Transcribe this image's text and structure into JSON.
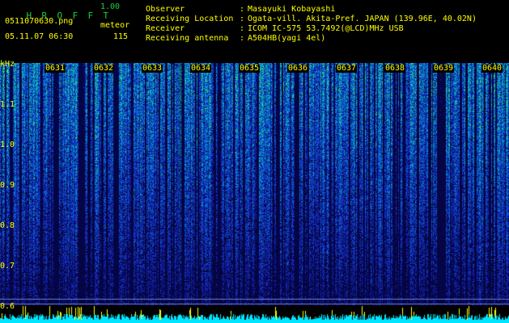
{
  "app": {
    "name_letters": [
      "H",
      "R",
      "O",
      "F",
      "F",
      "T"
    ],
    "version": "1.00"
  },
  "file": {
    "name": "0511070630.png",
    "datetime": "05.11.07 06:30"
  },
  "meteor": {
    "label": "meteor",
    "count": "115"
  },
  "info": [
    {
      "key": "Observer",
      "value": "Masayuki Kobayashi"
    },
    {
      "key": "Receiving Location",
      "value": "Ogata-vill. Akita-Pref. JAPAN (139.96E, 40.02N)"
    },
    {
      "key": "Receiver",
      "value": "ICOM IC-575 53.7492(@LCD)MHz USB"
    },
    {
      "key": "Receiving antenna",
      "value": "A504HB(yagi 4el)"
    }
  ],
  "axis": {
    "unit": "kHz",
    "y_ticks": [
      "1.1",
      "1.0",
      "0.9",
      "0.8",
      "0.7",
      "0.6"
    ],
    "x_ticks": [
      "0631",
      "0632",
      "0633",
      "0634",
      "0635",
      "0636",
      "0637",
      "0638",
      "0639",
      "0640"
    ]
  },
  "colors": {
    "accent_yellow": "#ffff00",
    "logo_green": "#1fcf3a",
    "baseline_cyan": "#00e5ff"
  }
}
